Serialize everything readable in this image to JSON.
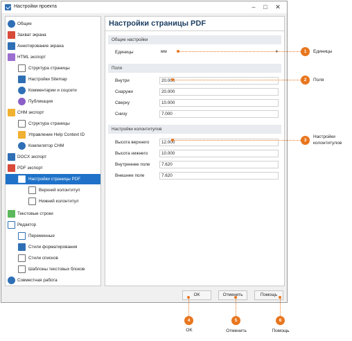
{
  "window": {
    "title": "Настройки проекта"
  },
  "sidebar": {
    "items": [
      {
        "label": "Общие",
        "icon": "gear-icon",
        "color": "#2f6fb5"
      },
      {
        "label": "Захват экрана",
        "icon": "capture-icon",
        "color": "#d84a3a"
      },
      {
        "label": "Аннотирование экрана",
        "icon": "annotate-icon",
        "color": "#2f6fb5"
      },
      {
        "label": "HTML экспорт",
        "icon": "html-icon",
        "color": "#9a6fd0"
      },
      {
        "label": "Структура страницы",
        "icon": "page-structure-icon",
        "color": "#6a6a6a"
      },
      {
        "label": "Настройки Sitemap",
        "icon": "sitemap-icon",
        "color": "#2f6fb5"
      },
      {
        "label": "Комментарии и соцсети",
        "icon": "comments-icon",
        "color": "#2f6fb5"
      },
      {
        "label": "Публикация",
        "icon": "cloud-icon",
        "color": "#8a5fc8"
      },
      {
        "label": "CHM экспорт",
        "icon": "chm-icon",
        "color": "#f0b030"
      },
      {
        "label": "Структура страницы",
        "icon": "page-structure-icon",
        "color": "#6a6a6a"
      },
      {
        "label": "Управление Help Context ID",
        "icon": "context-id-icon",
        "color": "#f0b030"
      },
      {
        "label": "Компилятор CHM",
        "icon": "compiler-icon",
        "color": "#2f6fb5"
      },
      {
        "label": "DOCX экспорт",
        "icon": "docx-icon",
        "color": "#2f6fb5"
      },
      {
        "label": "PDF экспорт",
        "icon": "pdf-icon",
        "color": "#d84a3a"
      },
      {
        "label": "Настройки страницы PDF",
        "icon": "page-settings-icon",
        "color": "#2f6fb5"
      },
      {
        "label": "Верхний колонтитул",
        "icon": "header-icon",
        "color": "#6a6a6a"
      },
      {
        "label": "Нижний колонтитул",
        "icon": "footer-icon",
        "color": "#6a6a6a"
      },
      {
        "label": "Текстовые строки",
        "icon": "text-strings-icon",
        "color": "#5cb85c"
      },
      {
        "label": "Редактор",
        "icon": "editor-icon",
        "color": "#2f6fb5"
      },
      {
        "label": "Переменные",
        "icon": "variables-icon",
        "color": "#2f6fb5"
      },
      {
        "label": "Стили форматирования",
        "icon": "format-styles-icon",
        "color": "#2f6fb5"
      },
      {
        "label": "Стили списков",
        "icon": "list-styles-icon",
        "color": "#6a6a6a"
      },
      {
        "label": "Шаблоны текстовых блоков",
        "icon": "text-block-templates-icon",
        "color": "#6a6a6a"
      },
      {
        "label": "Совместная работа",
        "icon": "collaboration-icon",
        "color": "#2f6fb5"
      }
    ],
    "selected": "Настройки страницы PDF"
  },
  "content": {
    "title": "Настройки страницы PDF",
    "general": {
      "header": "Общие настройки",
      "units_label": "Единицы",
      "units_value": "мм"
    },
    "margins": {
      "header": "Поля",
      "inside_label": "Внутри",
      "inside_value": "20.000",
      "outside_label": "Снаружи",
      "outside_value": "20.000",
      "top_label": "Сверху",
      "top_value": "10.000",
      "bottom_label": "Снизу",
      "bottom_value": "7.000"
    },
    "headers": {
      "header": "Настройки колонтитулов",
      "header_height_label": "Высота верхнего",
      "header_height_value": "12.000",
      "footer_height_label": "Высота нижнего",
      "footer_height_value": "10.000",
      "inner_margin_label": "Внутреннее поле",
      "inner_margin_value": "7.620",
      "outer_margin_label": "Внешнее поле",
      "outer_margin_value": "7.620"
    }
  },
  "buttons": {
    "ok": "OK",
    "cancel": "Отменить",
    "help": "Помощь"
  },
  "callouts": [
    {
      "num": "1",
      "text": "Единицы"
    },
    {
      "num": "2",
      "text": "Поля"
    },
    {
      "num": "3",
      "text": "Настройки колонтитулов"
    },
    {
      "num": "4",
      "text": "OK"
    },
    {
      "num": "5",
      "text": "Отменить"
    },
    {
      "num": "6",
      "text": "Помощь"
    }
  ],
  "colors": {
    "accent": "#e8761e",
    "selection": "#1f72c8",
    "title": "#1e3f63"
  }
}
